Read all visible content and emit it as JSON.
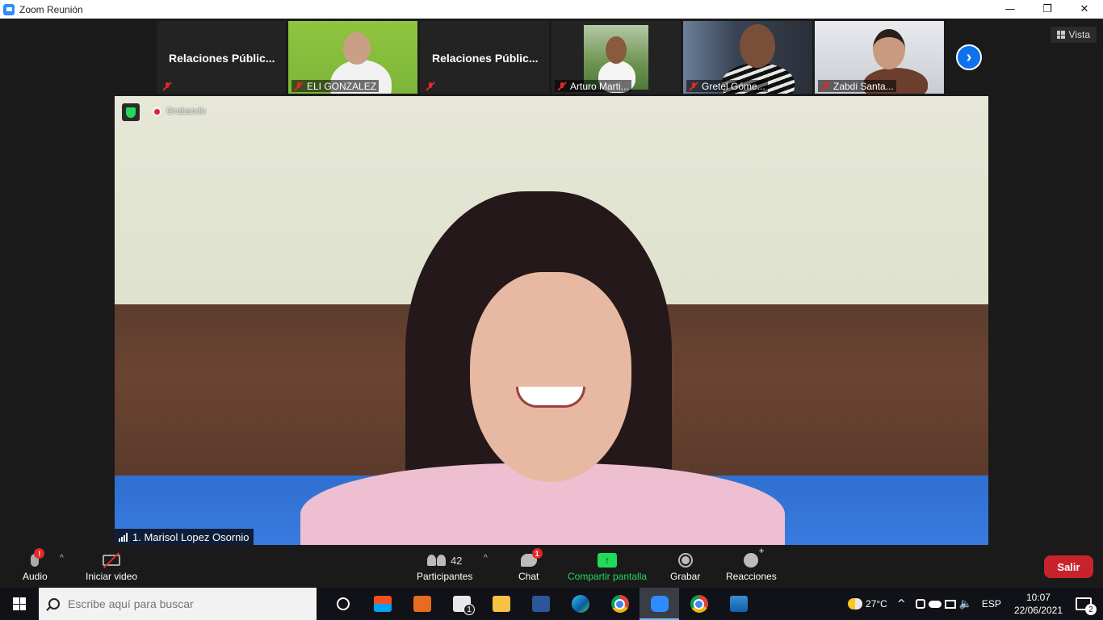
{
  "window": {
    "title": "Zoom Reunión",
    "minimize_glyph": "—",
    "restore_glyph": "❐",
    "close_glyph": "✕"
  },
  "meeting": {
    "view_label": "Vista",
    "next_glyph": "›",
    "recording_label": "Grabando",
    "speaker": {
      "name": "1. Marisol Lopez Osornio"
    },
    "participants": [
      {
        "type": "name-only",
        "display": "Relaciones Públic...",
        "muted": true
      },
      {
        "type": "video",
        "label": "ELI GONZALEZ",
        "muted": true
      },
      {
        "type": "name-only",
        "display": "Relaciones Públic...",
        "muted": true
      },
      {
        "type": "video",
        "label": "Arturo Marti...",
        "muted": true
      },
      {
        "type": "video",
        "label": "Gretel Góme...",
        "muted": true
      },
      {
        "type": "video",
        "label": "Zabdi Santa...",
        "muted": true
      }
    ]
  },
  "toolbar": {
    "audio_label": "Audio",
    "audio_badge": "!",
    "video_label": "Iniciar video",
    "participants_label": "Participantes",
    "participants_count": "42",
    "chat_label": "Chat",
    "chat_badge": "1",
    "share_label": "Compartir pantalla",
    "share_glyph": "↑",
    "record_label": "Grabar",
    "reactions_label": "Reacciones",
    "leave_label": "Salir",
    "caret_glyph": "^"
  },
  "taskbar": {
    "search_placeholder": "Escribe aquí para buscar",
    "mail_badge": "1",
    "weather": "27°C",
    "language": "ESP",
    "time": "10:07",
    "date": "22/06/2021",
    "notifications_count": "2",
    "tray_glyphs": {
      "chevron": "^",
      "volume": "🔈"
    }
  }
}
